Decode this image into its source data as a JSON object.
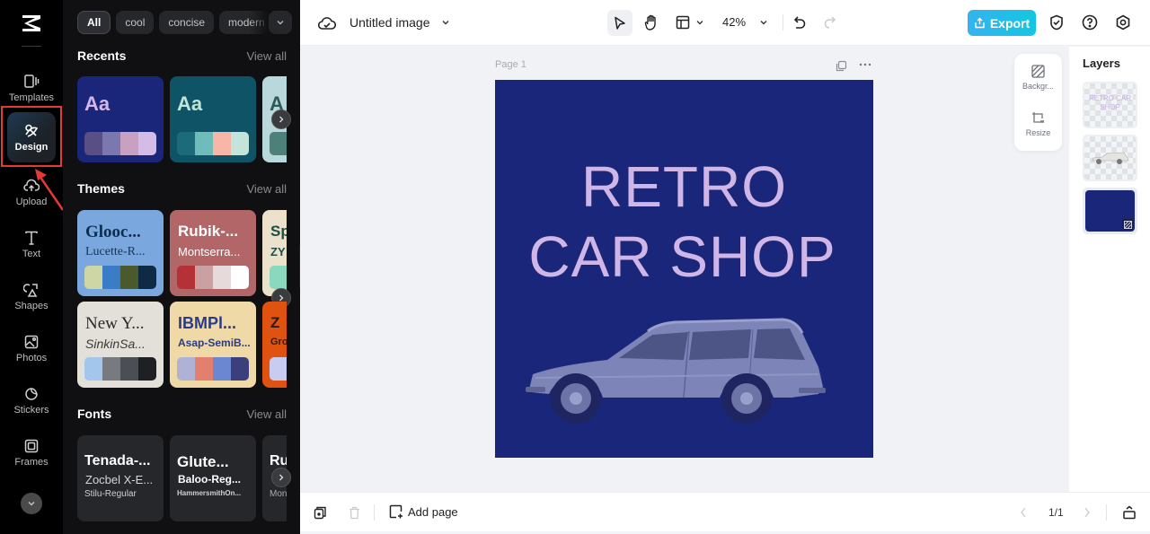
{
  "rail": {
    "items": [
      {
        "label": "Templates",
        "icon": "templates-icon"
      },
      {
        "label": "Design",
        "icon": "design-icon",
        "active": true
      },
      {
        "label": "Upload",
        "icon": "upload-icon"
      },
      {
        "label": "Text",
        "icon": "text-icon"
      },
      {
        "label": "Shapes",
        "icon": "shapes-icon"
      },
      {
        "label": "Photos",
        "icon": "photos-icon"
      },
      {
        "label": "Stickers",
        "icon": "stickers-icon"
      },
      {
        "label": "Frames",
        "icon": "frames-icon"
      }
    ]
  },
  "panel": {
    "chips": [
      "All",
      "cool",
      "concise",
      "modern"
    ],
    "recents": {
      "title": "Recents",
      "view_all": "View all",
      "cards": [
        {
          "sample": "Aa",
          "bg": "#1a267a",
          "fg": "#d3b7e8",
          "palette": [
            "#5a4f85",
            "#7a78ae",
            "#c7a0c2",
            "#d3bde6"
          ]
        },
        {
          "sample": "Aa",
          "bg": "#0f5366",
          "fg": "#bfe4d8",
          "palette": [
            "#1c6b7a",
            "#6fbcbb",
            "#f7b6a8",
            "#c3e4d8"
          ]
        },
        {
          "sample": "A",
          "bg": "#b9d8dc",
          "fg": "#2e5b59",
          "palette": [
            "#4c8079"
          ]
        }
      ]
    },
    "themes": {
      "title": "Themes",
      "view_all": "View all",
      "cards": [
        {
          "heading": "Glooc...",
          "sub": "Lucette-R...",
          "bg": "#7aa7dd",
          "fg": "#0d2d4f",
          "palette": [
            "#cfd6a6",
            "#3a7cc7",
            "#4a5a2c",
            "#0f2a44"
          ]
        },
        {
          "heading": "Rubik-...",
          "sub": "Montserra...",
          "bg": "#b26668",
          "fg": "#ffffff",
          "palette": [
            "#b43135",
            "#caa0a1",
            "#e6dada",
            "#ffffff"
          ]
        },
        {
          "heading": "Sp",
          "sub": "ZY",
          "bg": "#ece2cc",
          "fg": "#1d4d47",
          "palette": [
            "#8ad8bd"
          ]
        },
        {
          "heading": "New Y...",
          "sub": "SinkinSa...",
          "bg": "#e3dfd9",
          "fg": "#2a2a2a",
          "palette": [
            "#a3c6ed",
            "#777b80",
            "#4b4e55",
            "#1e2024"
          ]
        },
        {
          "heading": "IBMPl...",
          "sub": "Asap-SemiB...",
          "bg": "#efd9a6",
          "fg": "#2b3b85",
          "palette": [
            "#aeb3d6",
            "#e27f6e",
            "#6b87d2",
            "#3b3f7c"
          ]
        },
        {
          "heading": "Z",
          "sub": "Gro",
          "bg": "#e0520f",
          "fg": "#2a1a10",
          "palette": [
            "#c7ccf0"
          ]
        }
      ]
    },
    "fonts": {
      "title": "Fonts",
      "view_all": "View all",
      "cards": [
        {
          "l1": "Tenada-...",
          "l2": "Zocbel X-E...",
          "l3": "Stilu-Regular"
        },
        {
          "l1": "Glute...",
          "l2": "Baloo-Reg...",
          "l3": "HammersmithOn..."
        },
        {
          "l1": "Ru",
          "l2": "",
          "l3": "Mon"
        }
      ]
    }
  },
  "topbar": {
    "doc_title": "Untitled image",
    "zoom": "42%",
    "export_label": "Export"
  },
  "canvas": {
    "page_label": "Page 1",
    "background_color": "#1a267a",
    "text_color": "#cfb6e6",
    "headline_line1": "RETRO",
    "headline_line2": "CAR SHOP"
  },
  "side_tools": {
    "background_label": "Backgr...",
    "resize_label": "Resize"
  },
  "layers": {
    "title": "Layers",
    "items": [
      {
        "name": "text-layer",
        "preview_text": "RETRO CAR SHOP"
      },
      {
        "name": "car-image-layer"
      },
      {
        "name": "background-layer",
        "color": "#1a267a"
      }
    ]
  },
  "bottombar": {
    "add_page_label": "Add page",
    "page_indicator": "1/1"
  }
}
